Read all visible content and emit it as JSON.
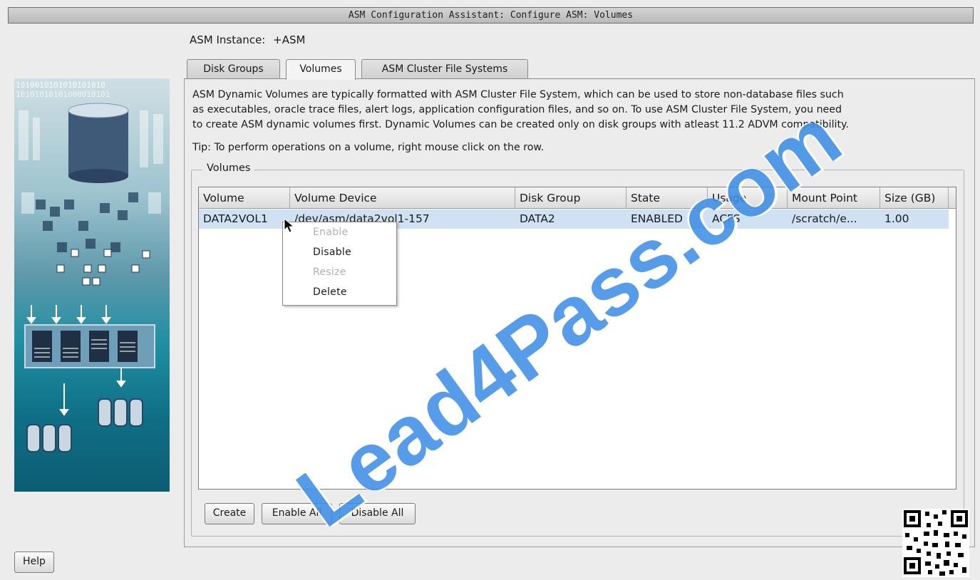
{
  "window": {
    "title": "ASM Configuration Assistant: Configure ASM: Volumes"
  },
  "asm_instance": {
    "label": "ASM Instance:",
    "value": "+ASM"
  },
  "tabs": [
    {
      "label": "Disk Groups",
      "active": false
    },
    {
      "label": "Volumes",
      "active": true
    },
    {
      "label": "ASM Cluster File Systems",
      "active": false
    }
  ],
  "description": [
    "ASM Dynamic Volumes are typically formatted with ASM Cluster File System, which can be used to store non-database files such",
    "as executables, oracle trace files, alert logs, application configuration files, and so on. To use ASM Cluster File System, you need",
    "to create ASM dynamic volumes first. Dynamic Volumes can be created only on disk groups with atleast 11.2 ADVM compatibility."
  ],
  "tip": "Tip: To perform operations on a volume, right mouse click on the row.",
  "volumes_group_label": "Volumes",
  "table": {
    "columns": [
      "Volume",
      "Volume Device",
      "Disk Group",
      "State",
      "Usage",
      "Mount Point",
      "Size (GB)"
    ],
    "rows": [
      [
        "DATA2VOL1",
        "/dev/asm/data2vol1-157",
        "DATA2",
        "ENABLED",
        "ACFS",
        "/scratch/e...",
        "1.00"
      ]
    ],
    "selected_row_color": "#cfe1f3"
  },
  "context_menu": [
    {
      "label": "Enable",
      "enabled": false
    },
    {
      "label": "Disable",
      "enabled": true
    },
    {
      "label": "Resize",
      "enabled": false
    },
    {
      "label": "Delete",
      "enabled": true
    }
  ],
  "buttons": {
    "create": "Create",
    "enable_all": "Enable All",
    "disable_all": "Disable All",
    "help": "Help"
  },
  "banner": {
    "binary_row_1": "1010010101010101010",
    "binary_row_2": "10101010101000010101"
  },
  "watermark": "Lead4Pass.com",
  "accent_color": "#3f8fe6"
}
